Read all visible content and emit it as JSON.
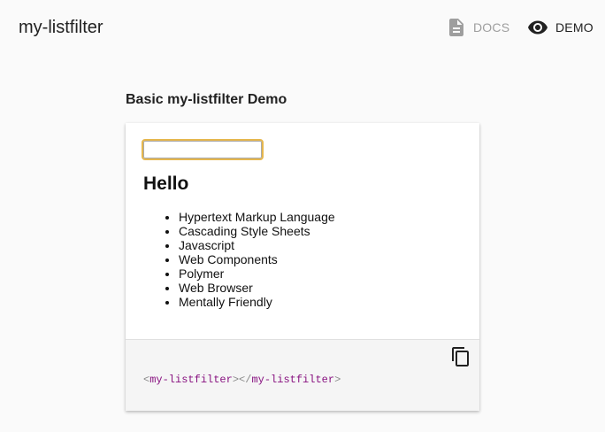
{
  "header": {
    "title": "my-listfilter",
    "nav": {
      "docs_label": "DOCS",
      "demo_label": "DEMO"
    },
    "icons": {
      "docs": "document-icon",
      "demo": "eye-icon"
    }
  },
  "section": {
    "title": "Basic my-listfilter Demo"
  },
  "demo": {
    "filter_input": {
      "value": "",
      "placeholder": ""
    },
    "heading": "Hello",
    "items": [
      "Hypertext Markup Language",
      "Cascading Style Sheets",
      "Javascript",
      "Web Components",
      "Polymer",
      "Web Browser",
      "Mentally Friendly"
    ]
  },
  "code": {
    "open_bracket": "<",
    "open_tag": "my-listfilter",
    "mid": "></",
    "close_tag": "my-listfilter",
    "close_bracket": ">",
    "copy_icon": "copy-icon"
  },
  "colors": {
    "focus_outline": "#e6b74e",
    "tag": "#881280",
    "nav_inactive": "#9e9e9e"
  }
}
